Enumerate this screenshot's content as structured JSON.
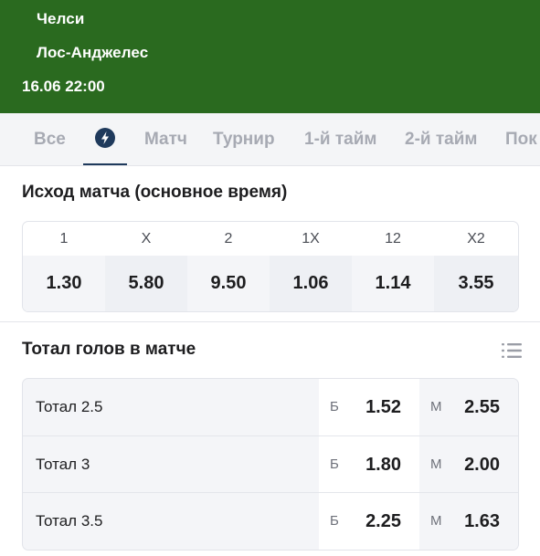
{
  "match": {
    "team1": "Челси",
    "team2": "Лос-Анджелес",
    "datetime": "16.06 22:00"
  },
  "tabs": [
    {
      "label": "Все"
    },
    {
      "label": "",
      "icon": "lightning-icon",
      "active": true
    },
    {
      "label": "Матч"
    },
    {
      "label": "Турнир"
    },
    {
      "label": "1-й тайм"
    },
    {
      "label": "2-й тайм"
    },
    {
      "label": "Пок"
    }
  ],
  "outcome": {
    "title": "Исход матча (основное время)",
    "columns": [
      {
        "label": "1",
        "value": "1.30"
      },
      {
        "label": "X",
        "value": "5.80"
      },
      {
        "label": "2",
        "value": "9.50"
      },
      {
        "label": "1X",
        "value": "1.06"
      },
      {
        "label": "12",
        "value": "1.14"
      },
      {
        "label": "X2",
        "value": "3.55"
      }
    ]
  },
  "totals": {
    "title": "Тотал голов в матче",
    "over_letter": "Б",
    "under_letter": "М",
    "rows": [
      {
        "label": "Тотал 2.5",
        "over": "1.52",
        "under": "2.55"
      },
      {
        "label": "Тотал 3",
        "over": "1.80",
        "under": "2.00"
      },
      {
        "label": "Тотал 3.5",
        "over": "2.25",
        "under": "1.63"
      }
    ]
  },
  "colors": {
    "header_green": "#2a6a1f",
    "accent_navy": "#1f3a5c",
    "tab_inactive": "#a7aab3"
  }
}
